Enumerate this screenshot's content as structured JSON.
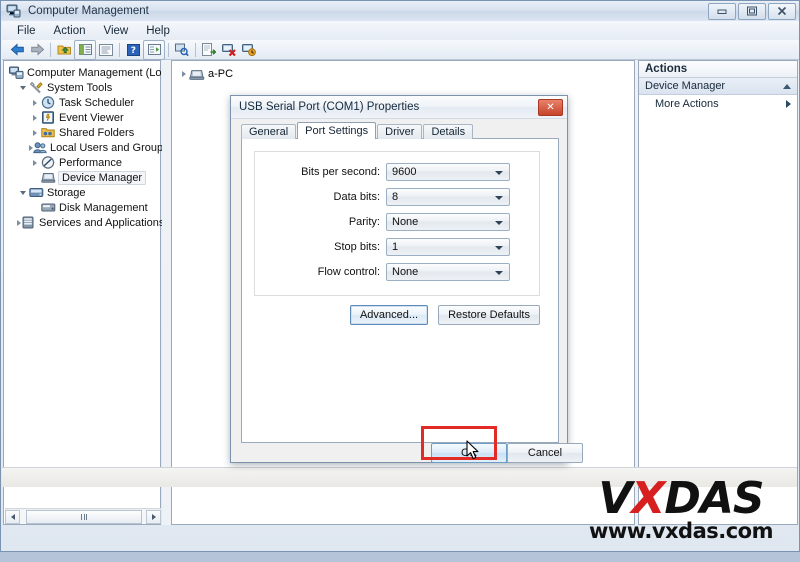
{
  "window": {
    "title": "Computer Management",
    "icon": "computer-management-icon",
    "buttons": {
      "minimize": "–",
      "maximize": "□",
      "close": "✕"
    }
  },
  "menu": {
    "items": [
      "File",
      "Action",
      "View",
      "Help"
    ]
  },
  "toolbar": {
    "items": [
      {
        "name": "back-icon",
        "glyph": "←"
      },
      {
        "name": "forward-icon",
        "glyph": "→"
      },
      {
        "name": "up-folder-icon",
        "glyph": "⬆"
      },
      {
        "name": "show-hide-tree-icon",
        "glyph": "▤"
      },
      {
        "name": "properties-icon",
        "glyph": "☰"
      },
      {
        "name": "help-icon",
        "glyph": "?"
      },
      {
        "name": "console-tree-icon",
        "glyph": "▥"
      },
      {
        "name": "scan-hardware-icon",
        "glyph": "⌕"
      },
      {
        "name": "export-list-icon",
        "glyph": "⇨"
      },
      {
        "name": "uninstall-device-icon",
        "glyph": "✖"
      },
      {
        "name": "update-driver-icon",
        "glyph": "↻"
      }
    ]
  },
  "sidebar": {
    "items": [
      {
        "label": "Computer Management (Local",
        "level": 0,
        "icon": "computer-management-icon",
        "expander": "none",
        "selected": false
      },
      {
        "label": "System Tools",
        "level": 1,
        "icon": "system-tools-icon",
        "expander": "open",
        "selected": false
      },
      {
        "label": "Task Scheduler",
        "level": 2,
        "icon": "clock-icon",
        "expander": "closed",
        "selected": false
      },
      {
        "label": "Event Viewer",
        "level": 2,
        "icon": "event-viewer-icon",
        "expander": "closed",
        "selected": false
      },
      {
        "label": "Shared Folders",
        "level": 2,
        "icon": "shared-folders-icon",
        "expander": "closed",
        "selected": false
      },
      {
        "label": "Local Users and Groups",
        "level": 2,
        "icon": "users-icon",
        "expander": "closed",
        "selected": false
      },
      {
        "label": "Performance",
        "level": 2,
        "icon": "performance-icon",
        "expander": "closed",
        "selected": false
      },
      {
        "label": "Device Manager",
        "level": 2,
        "icon": "device-manager-icon",
        "expander": "none",
        "selected": true
      },
      {
        "label": "Storage",
        "level": 1,
        "icon": "storage-icon",
        "expander": "open",
        "selected": false
      },
      {
        "label": "Disk Management",
        "level": 2,
        "icon": "disk-management-icon",
        "expander": "none",
        "selected": false
      },
      {
        "label": "Services and Applications",
        "level": 1,
        "icon": "services-icon",
        "expander": "closed",
        "selected": false
      }
    ]
  },
  "content": {
    "node_label": "a-PC",
    "node_icon": "computer-icon"
  },
  "actions": {
    "header": "Actions",
    "group_label": "Device Manager",
    "group_chevron": "chevron-up-icon",
    "more_label": "More Actions",
    "more_arrow": "arrow-right-icon"
  },
  "dialog": {
    "title": "USB Serial Port (COM1) Properties",
    "close_glyph": "✕",
    "tabs": [
      {
        "label": "General",
        "active": false
      },
      {
        "label": "Port Settings",
        "active": true
      },
      {
        "label": "Driver",
        "active": false
      },
      {
        "label": "Details",
        "active": false
      }
    ],
    "fields": [
      {
        "label": "Bits per second:",
        "value": "9600"
      },
      {
        "label": "Data bits:",
        "value": "8"
      },
      {
        "label": "Parity:",
        "value": "None"
      },
      {
        "label": "Stop bits:",
        "value": "1"
      },
      {
        "label": "Flow control:",
        "value": "None"
      }
    ],
    "advanced_label": "Advanced...",
    "restore_label": "Restore Defaults",
    "ok_label": "OK",
    "cancel_label": "Cancel"
  },
  "annotation": {
    "highlight_color": "#e22b26",
    "target": "ok-button"
  },
  "watermark": {
    "brand_v": "V",
    "brand_x": "X",
    "brand_rest": "DAS",
    "url": "www.vxdas.com"
  }
}
